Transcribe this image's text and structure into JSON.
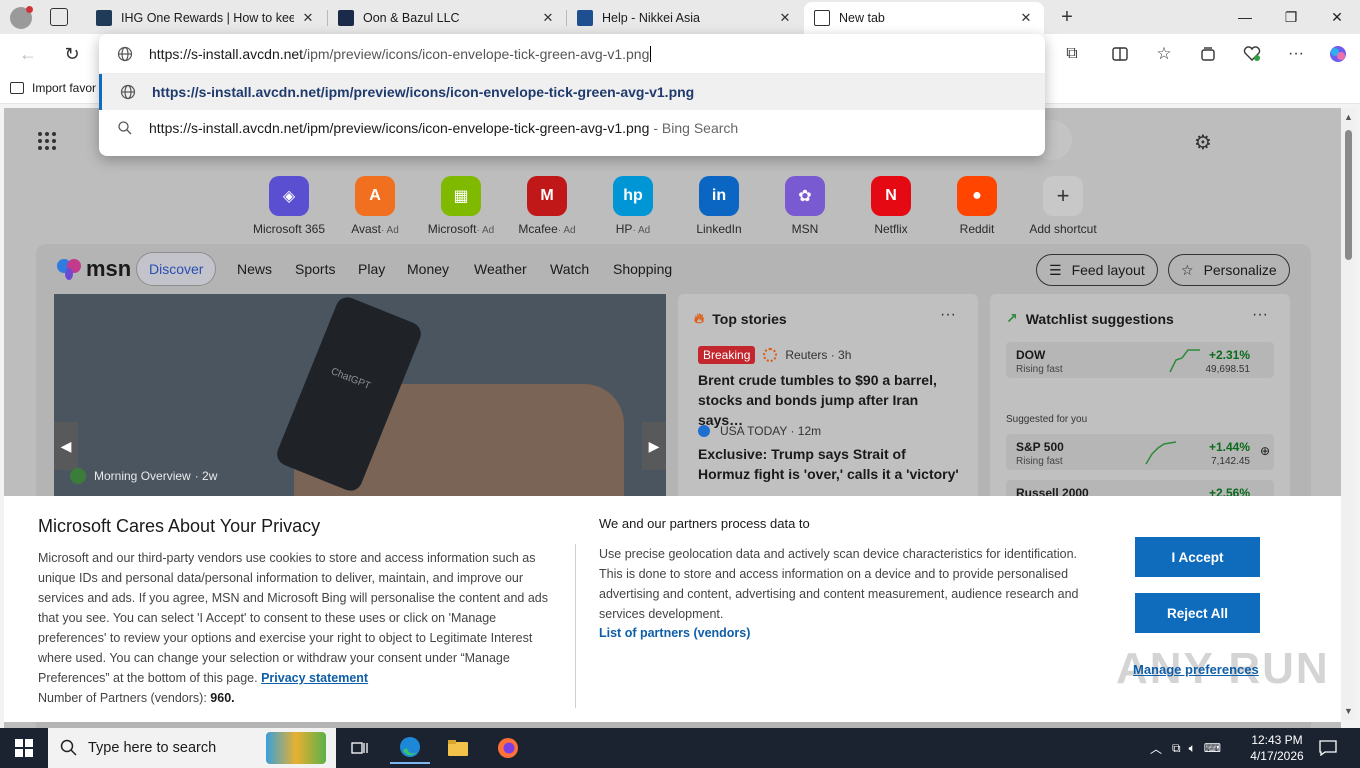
{
  "tabs": [
    {
      "label": "IHG One Rewards | How to keep y",
      "favicon_color": "#1f3b57"
    },
    {
      "label": "Oon & Bazul LLC",
      "favicon_color": "#1a2a48"
    },
    {
      "label": "Help - Nikkei Asia",
      "favicon_color": "#1d4f91",
      "favicon_text": "NIKKEI Asia"
    },
    {
      "label": "New tab",
      "active": true
    }
  ],
  "window_controls": {
    "minimize": "—",
    "maximize": "❐",
    "close": "✕"
  },
  "favorites_bar": {
    "import_label": "Import favor"
  },
  "omnibox": {
    "url_host": "https://s-install.avcdn.net",
    "url_path": "/ipm/preview/icons/icon-envelope-tick-green-avg-v1.png",
    "suggestions": [
      {
        "text": "https://s-install.avcdn.net/ipm/preview/icons/icon-envelope-tick-green-avg-v1.png",
        "suffix": "",
        "icon": "globe-icon",
        "selected": true
      },
      {
        "text": "https://s-install.avcdn.net/ipm/preview/icons/icon-envelope-tick-green-avg-v1.png",
        "suffix": "- Bing Search",
        "icon": "search-icon",
        "selected": false
      }
    ]
  },
  "shortcuts": [
    {
      "label": "Microsoft 365",
      "ad": "",
      "color": "#5a4ed1",
      "glyph": "◈"
    },
    {
      "label": "Avast",
      "ad": "· Ad",
      "color": "#f07020",
      "glyph": "A"
    },
    {
      "label": "Microsoft",
      "ad": "· Ad",
      "color": "#7fba00",
      "glyph": "▦"
    },
    {
      "label": "Mcafee",
      "ad": "· Ad",
      "color": "#c01818",
      "glyph": "M"
    },
    {
      "label": "HP",
      "ad": "· Ad",
      "color": "#0096d6",
      "glyph": "hp"
    },
    {
      "label": "LinkedIn",
      "ad": "",
      "color": "#0a66c2",
      "glyph": "in"
    },
    {
      "label": "MSN",
      "ad": "",
      "color": "#7a5ad1",
      "glyph": "✿"
    },
    {
      "label": "Netflix",
      "ad": "",
      "color": "#e50914",
      "glyph": "N"
    },
    {
      "label": "Reddit",
      "ad": "",
      "color": "#ff4500",
      "glyph": "●"
    },
    {
      "label": "Add shortcut",
      "ad": "",
      "color": "#c8c8c8",
      "glyph": "+"
    }
  ],
  "feed": {
    "logo_text": "msn",
    "nav": [
      "Discover",
      "News",
      "Sports",
      "Play",
      "Money",
      "Weather",
      "Watch",
      "Shopping"
    ],
    "feed_layout_label": "Feed layout",
    "personalize_label": "Personalize",
    "hero_caption": "Morning Overview",
    "hero_age": "· 2w",
    "hero_phone_text": "ChatGPT"
  },
  "top_stories": {
    "title": "Top stories",
    "more": "···",
    "items": [
      {
        "badge": "Breaking",
        "source": "Reuters · 3h",
        "headline": "Brent crude tumbles to $90 a barrel, stocks and bonds jump after Iran says…"
      },
      {
        "badge": "",
        "source": "USA TODAY · 12m",
        "headline": "Exclusive: Trump says Strait of Hormuz fight is 'over,' calls it a 'victory'"
      }
    ]
  },
  "watchlist": {
    "title": "Watchlist suggestions",
    "more": "···",
    "suggested_label": "Suggested for you",
    "rows": [
      {
        "symbol": "DOW",
        "sub": "Rising fast",
        "pct": "+2.31%",
        "value": "49,698.51"
      },
      {
        "symbol": "S&P 500",
        "sub": "Rising fast",
        "pct": "+1.44%",
        "value": "7,142.45"
      },
      {
        "symbol": "Russell 2000",
        "sub": "",
        "pct": "+2.56%",
        "value": ""
      }
    ]
  },
  "privacy": {
    "title": "Microsoft Cares About Your Privacy",
    "body": "Microsoft and our third-party vendors use cookies to store and access information such as unique IDs and personal data/personal information to deliver, maintain, and improve our services and ads. If you agree, MSN and Microsoft Bing will personalise the content and ads that you see. You can select 'I Accept' to consent to these uses or click on 'Manage preferences' to review your options and exercise your right to object to Legitimate Interest where used. You can change your selection or withdraw your consent under “Manage Preferences” at the bottom of this page.",
    "privacy_link": "Privacy statement",
    "partners_prefix": "Number of Partners (vendors):",
    "partners_count": "960.",
    "right_title": "We and our partners process data to",
    "right_body": "Use precise geolocation data and actively scan device characteristics for identification. This is done to store and access information on a device and to provide personalised advertising and content, advertising and content measurement, audience research and services development.",
    "vendors_link": "List of partners (vendors)",
    "accept_label": "I Accept",
    "reject_label": "Reject All",
    "manage_label": "Manage preferences",
    "watermark": "ANY RUN"
  },
  "taskbar": {
    "search_placeholder": "Type here to search",
    "time": "12:43 PM",
    "date": "4/17/2026"
  },
  "colors": {
    "accent": "#0f6cbd",
    "breaking": "#c4262e",
    "positive": "#0b6a1b"
  }
}
